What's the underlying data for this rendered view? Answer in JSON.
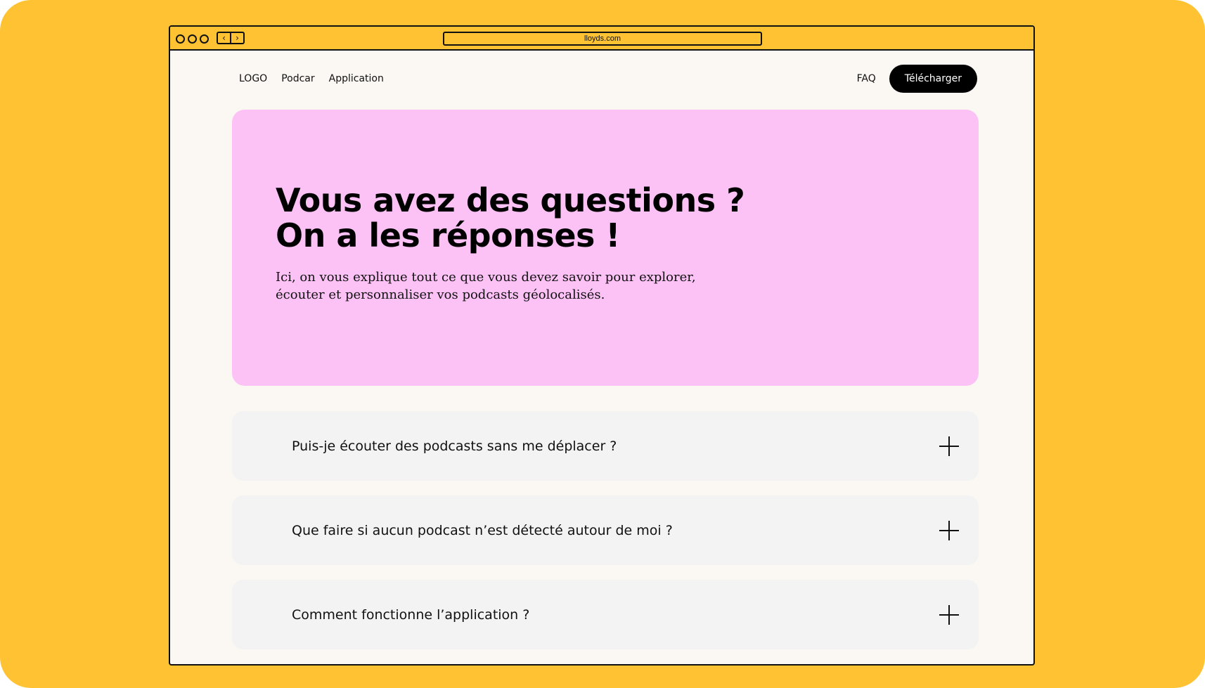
{
  "browser": {
    "url": "lloyds.com",
    "back_icon": "chevron-left-icon",
    "forward_icon": "chevron-right-icon",
    "back_glyph": "‹",
    "forward_glyph": "›"
  },
  "nav": {
    "logo": "LOGO",
    "links": [
      "Podcar",
      "Application"
    ],
    "faq": "FAQ",
    "download": "Télécharger"
  },
  "hero": {
    "title_lines": [
      "Vous avez des questions ?",
      "On a les réponses !"
    ],
    "description_lines": [
      "Ici, on vous explique tout ce que vous devez savoir pour explorer,",
      "écouter et personnaliser vos podcasts géolocalisés."
    ]
  },
  "faq": {
    "items": [
      {
        "question": "Puis-je écouter des podcasts sans me déplacer ?",
        "icon": "plus-icon"
      },
      {
        "question": "Que faire si aucun podcast n’est détecté autour de moi ?",
        "icon": "plus-icon"
      },
      {
        "question": "Comment fonctionne l’application ?",
        "icon": "plus-icon"
      }
    ]
  },
  "colors": {
    "background": "#FFC233",
    "page": "#FBF8F3",
    "hero": "#FCC2F6",
    "faq_item": "#F3F3F3",
    "button": "#000000"
  }
}
